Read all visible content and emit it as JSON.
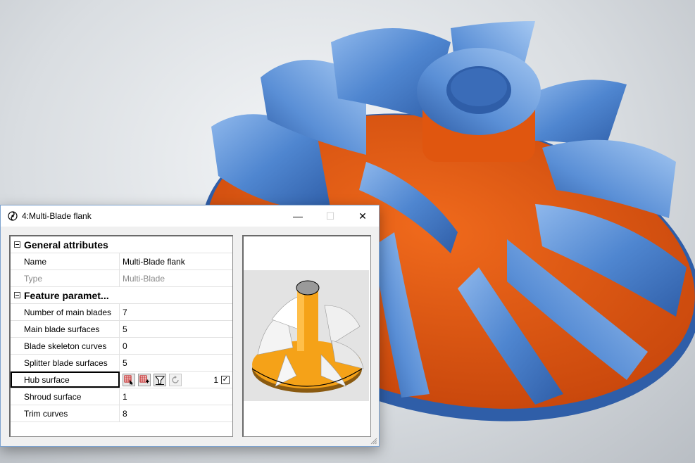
{
  "window": {
    "title": "4:Multi-Blade flank",
    "controls": {
      "minimize": "—",
      "maximize": "☐",
      "close": "✕"
    }
  },
  "grid": {
    "sections": [
      {
        "title": "General attributes",
        "rows": [
          {
            "name": "Name",
            "value": "Multi-Blade flank"
          },
          {
            "name": "Type",
            "value": "Multi-Blade"
          }
        ]
      },
      {
        "title": "Feature paramet...",
        "rows": [
          {
            "name": "Number of main blades",
            "value": "7"
          },
          {
            "name": "Main blade surfaces",
            "value": "5"
          },
          {
            "name": "Blade skeleton curves",
            "value": "0"
          },
          {
            "name": "Splitter blade surfaces",
            "value": "5"
          },
          {
            "name": "Hub surface",
            "value": "1"
          },
          {
            "name": "Shroud surface",
            "value": "1"
          },
          {
            "name": "Trim curves",
            "value": "8"
          }
        ]
      }
    ],
    "hub_checked": "✓"
  },
  "icons": {
    "app": "impeller-app-icon",
    "select_surface": "select-surface-icon",
    "add_surface": "add-surface-icon",
    "filter": "filter-icon",
    "reset": "reset-icon"
  },
  "colors": {
    "blade_blue": "#4f86d0",
    "hub_orange": "#e0560f",
    "preview_orange": "#f5a218",
    "window_border": "#7da2ce"
  }
}
